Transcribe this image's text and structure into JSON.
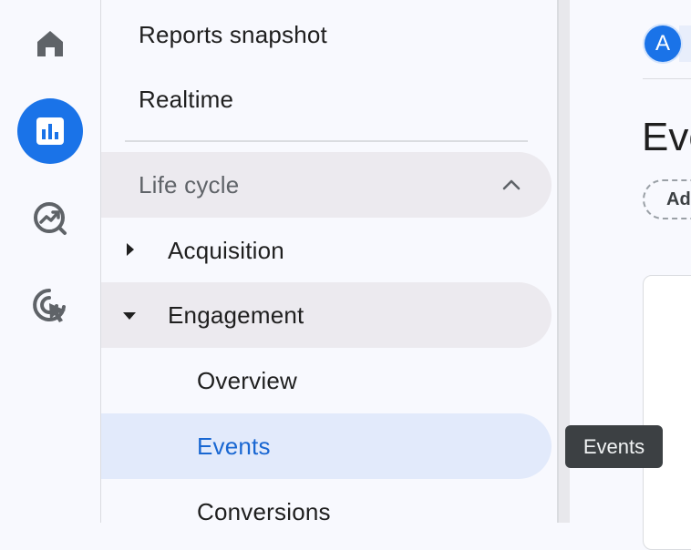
{
  "rail": {
    "items": [
      {
        "icon": "home-icon",
        "active": false
      },
      {
        "icon": "reports-icon",
        "active": true
      },
      {
        "icon": "explore-icon",
        "active": false
      },
      {
        "icon": "advertising-icon",
        "active": false
      }
    ],
    "accent": "#1a73e8"
  },
  "nav": {
    "reports_snapshot": "Reports snapshot",
    "realtime": "Realtime",
    "lifecycle": "Life cycle",
    "acquisition": "Acquisition",
    "engagement": "Engagement",
    "overview": "Overview",
    "events": "Events",
    "conversions": "Conversions"
  },
  "main": {
    "avatar_letter": "A",
    "title": "Eve",
    "add_chip": "Ad"
  },
  "tooltip": {
    "text": "Events"
  },
  "colors": {
    "selected_text": "#1967d2",
    "selected_bg": "#e2eafb",
    "group_bg": "#eceaef"
  }
}
